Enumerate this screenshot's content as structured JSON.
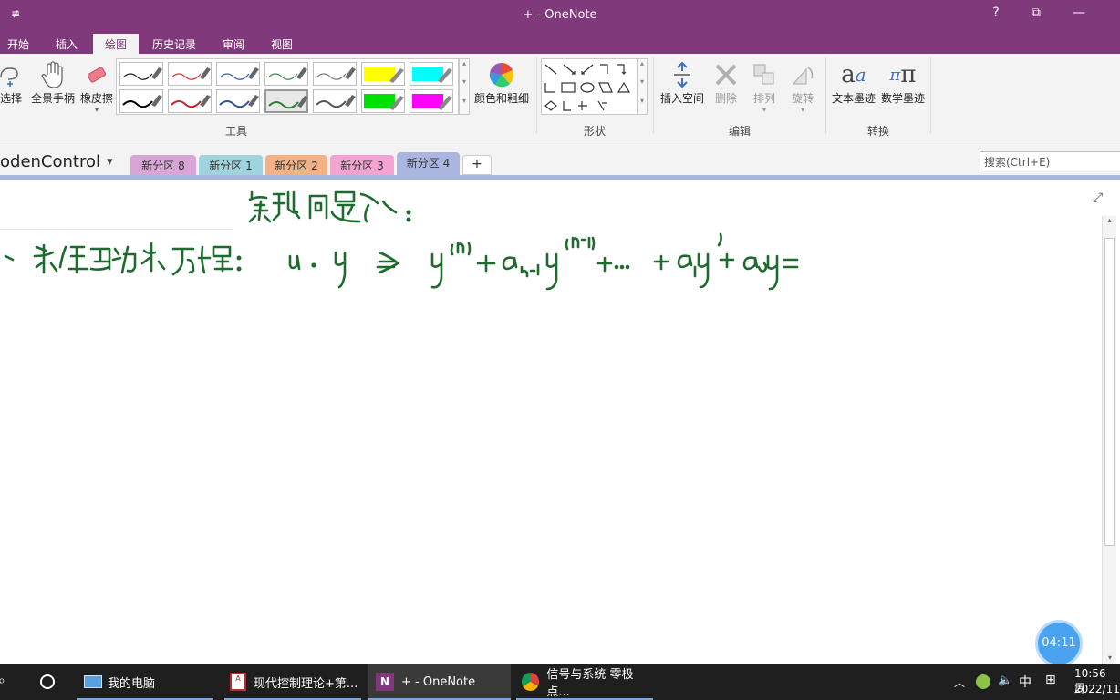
{
  "window": {
    "title": "+ - OneNote",
    "quick_access": "≢",
    "controls": {
      "help": "?",
      "restore": "⧉",
      "minimize": "—"
    }
  },
  "ribbon_tabs": [
    "开始",
    "插入",
    "绘图",
    "历史记录",
    "审阅",
    "视图"
  ],
  "ribbon": {
    "tools": {
      "label": "工具",
      "lasso_label": "套索选择",
      "lasso_visible": "选择",
      "hand_label": "全景手柄",
      "eraser_label": "橡皮擦",
      "color_label": "颜色和粗细",
      "pen_colors": [
        "#222222",
        "#d33a3a",
        "#3a5fa8",
        "#3f8a4b",
        "#7a7a7a",
        "#ffff00",
        "#00ffff",
        "#000000",
        "#c0262c",
        "#2f5597",
        "#2e7d32",
        "#555555",
        "#00e000",
        "#ff00ff"
      ]
    },
    "shapes": {
      "label": "形状"
    },
    "edit": {
      "label": "编辑",
      "insert_space_label": "插入空间",
      "delete_label": "删除",
      "arrange_label": "排列",
      "rotate_label": "旋转"
    },
    "convert": {
      "label": "转换",
      "ink_to_text_label": "文本墨迹",
      "ink_to_math_label": "数学墨迹"
    }
  },
  "notebook": {
    "name_visible": "odenControl",
    "dropdown": "▾",
    "sections": [
      {
        "label": "新分区 8",
        "color": "#d9a5d6"
      },
      {
        "label": "新分区 1",
        "color": "#9fd3de"
      },
      {
        "label": "新分区 2",
        "color": "#f4b183"
      },
      {
        "label": "新分区 3",
        "color": "#f3a3d1"
      },
      {
        "label": "新分区 4",
        "color": "#aab6e0"
      }
    ],
    "add_section": "+",
    "search_placeholder": "搜索(Ctrl+E)"
  },
  "page": {
    "ink_color": "#1e6b2f",
    "expand_icon": "⤢"
  },
  "timer": "04:11",
  "taskbar": {
    "items": [
      {
        "label": "我的电脑"
      },
      {
        "label": "现代控制理论+第..."
      },
      {
        "label": "+ - OneNote"
      },
      {
        "label": "信号与系统 零极点..."
      }
    ],
    "ime": "中",
    "time": "10:56 周",
    "date": "2022/11/"
  }
}
